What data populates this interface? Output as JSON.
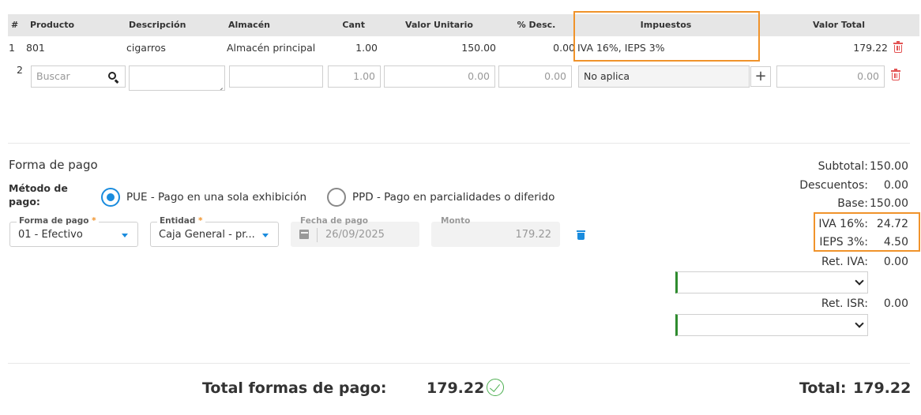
{
  "table": {
    "headers": {
      "num": "#",
      "producto": "Producto",
      "descripcion": "Descripción",
      "almacen": "Almacén",
      "cant": "Cant",
      "valor_unitario": "Valor Unitario",
      "desc": "% Desc.",
      "impuestos": "Impuestos",
      "valor_total": "Valor Total"
    },
    "row1": {
      "num": "1",
      "producto": "801",
      "descripcion": "cigarros",
      "almacen": "Almacén principal",
      "cant": "1.00",
      "valor_unitario": "150.00",
      "desc": "0.00",
      "impuestos": "IVA 16%, IEPS 3%",
      "valor_total": "179.22"
    },
    "row2": {
      "num": "2",
      "producto_placeholder": "Buscar",
      "cant": "1.00",
      "valor_unitario": "0.00",
      "desc": "0.00",
      "impuestos": "No aplica",
      "add": "+",
      "valor_total": "0.00"
    }
  },
  "payment": {
    "title": "Forma de pago",
    "method_label": "Método de pago:",
    "option_pue": "PUE - Pago en una sola exhibición",
    "option_ppd": "PPD - Pago en parcialidades o diferido",
    "selected": "PUE",
    "forma_label": "Forma de pago",
    "forma_value": "01 - Efectivo",
    "entidad_label": "Entidad",
    "entidad_value": "Caja General - pr...",
    "required_mark": "*",
    "fecha_label": "Fecha de pago",
    "fecha_value": "26/09/2025",
    "monto_label": "Monto",
    "monto_value": "179.22"
  },
  "totals": {
    "subtotal_label": "Subtotal:",
    "subtotal_value": "150.00",
    "descuentos_label": "Descuentos:",
    "descuentos_value": "0.00",
    "base_label": "Base:",
    "base_value": "150.00",
    "iva_label": "IVA 16%:",
    "iva_value": "24.72",
    "ieps_label": "IEPS 3%:",
    "ieps_value": "4.50",
    "ret_iva_label": "Ret. IVA:",
    "ret_iva_value": "0.00",
    "ret_isr_label": "Ret. ISR:",
    "ret_isr_value": "0.00"
  },
  "footer": {
    "total_formas_label": "Total formas de pago:",
    "total_formas_value": "179.22",
    "total_label": "Total:",
    "total_value": "179.22"
  },
  "colors": {
    "accent": "#1a8cde",
    "highlight": "#f0932b",
    "delete": "#e35454",
    "success": "#4caf50"
  }
}
